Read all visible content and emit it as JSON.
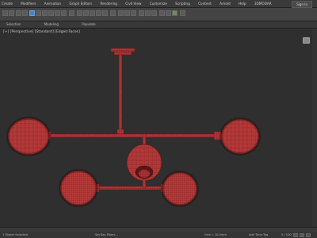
{
  "menu": {
    "items": [
      "Create",
      "Modifiers",
      "Animation",
      "Graph Editors",
      "Rendering",
      "Civil View",
      "Customize",
      "Scripting",
      "Content",
      "Arnold",
      "Help",
      "3DMODAR"
    ],
    "signin_label": "Sign In"
  },
  "subrow": {
    "left_label": "Selection",
    "mid_label": "Modeling",
    "right_label": "Populate"
  },
  "viewport": {
    "label": "[+] [Perspective] [Standard] [Edged Faces]"
  },
  "status": {
    "left": "1 Object Selected",
    "sub": "Set Key Filters...",
    "grid": "Grid = 10.0mm",
    "addtime": "Add Time Tag",
    "frame": "0 / 100"
  },
  "colors": {
    "model_red": "#b83a3a",
    "model_dark": "#6e1f1f",
    "viewport_bg": "#2f2f2f"
  }
}
